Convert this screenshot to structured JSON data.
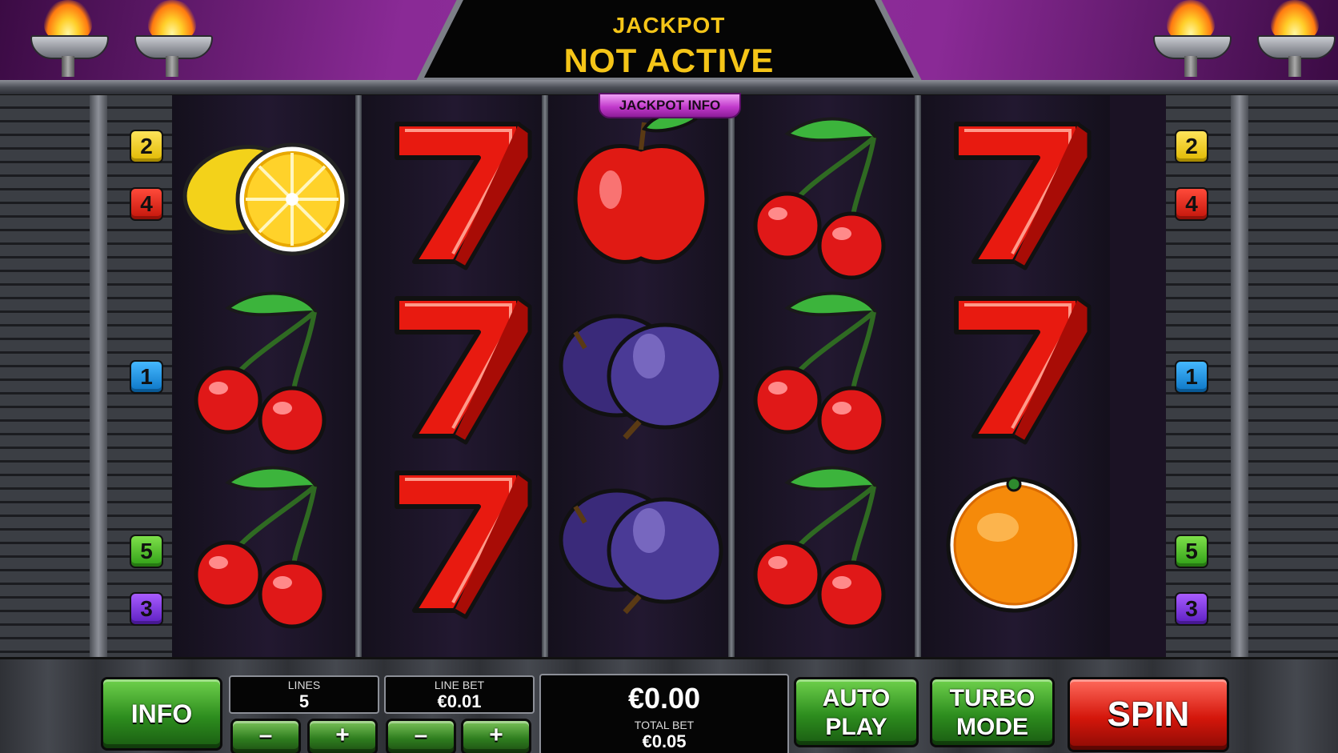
{
  "jackpot": {
    "line1": "JACKPOT",
    "line2": "NOT ACTIVE",
    "info_button": "JACKPOT INFO"
  },
  "paylines": {
    "left": [
      "2",
      "4",
      "1",
      "5",
      "3"
    ],
    "right": [
      "2",
      "4",
      "1",
      "5",
      "3"
    ],
    "colors": {
      "1": "#1e90e6",
      "2": "#f2d21a",
      "3": "#7a2ee6",
      "4": "#e2281a",
      "5": "#4cc12e"
    }
  },
  "reels": [
    [
      "lemon-icon",
      "cherries-icon",
      "cherries-icon"
    ],
    [
      "seven-icon",
      "seven-icon",
      "seven-icon"
    ],
    [
      "apple-icon",
      "plums-icon",
      "plums-icon"
    ],
    [
      "cherries-icon",
      "cherries-icon",
      "cherries-icon"
    ],
    [
      "seven-icon",
      "seven-icon",
      "orange-icon"
    ]
  ],
  "controls": {
    "info": "INFO",
    "lines_label": "LINES",
    "lines_value": "5",
    "line_bet_label": "LINE BET",
    "line_bet_value": "€0.01",
    "minus": "–",
    "plus": "+",
    "balance": "€0.00",
    "total_bet_label": "TOTAL BET",
    "total_bet_value": "€0.05",
    "auto_play": "AUTO PLAY",
    "turbo_mode": "TURBO MODE",
    "spin": "SPIN"
  }
}
